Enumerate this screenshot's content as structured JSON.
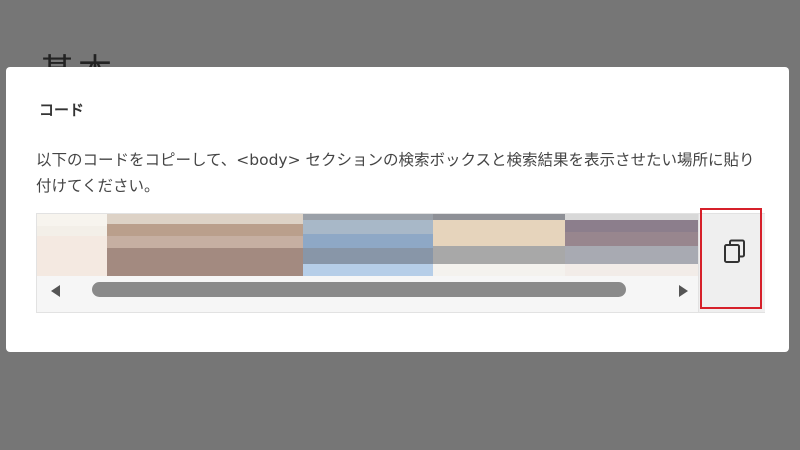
{
  "background": {
    "heading_partial": "基本"
  },
  "dialog": {
    "title": "コード",
    "description": "以下のコードをコピーして、<body> セクションの検索ボックスと検索結果を表示させたい場所に貼り付けてください。",
    "copy_icon": "copy-icon",
    "highlight_color": "#d6202a"
  }
}
